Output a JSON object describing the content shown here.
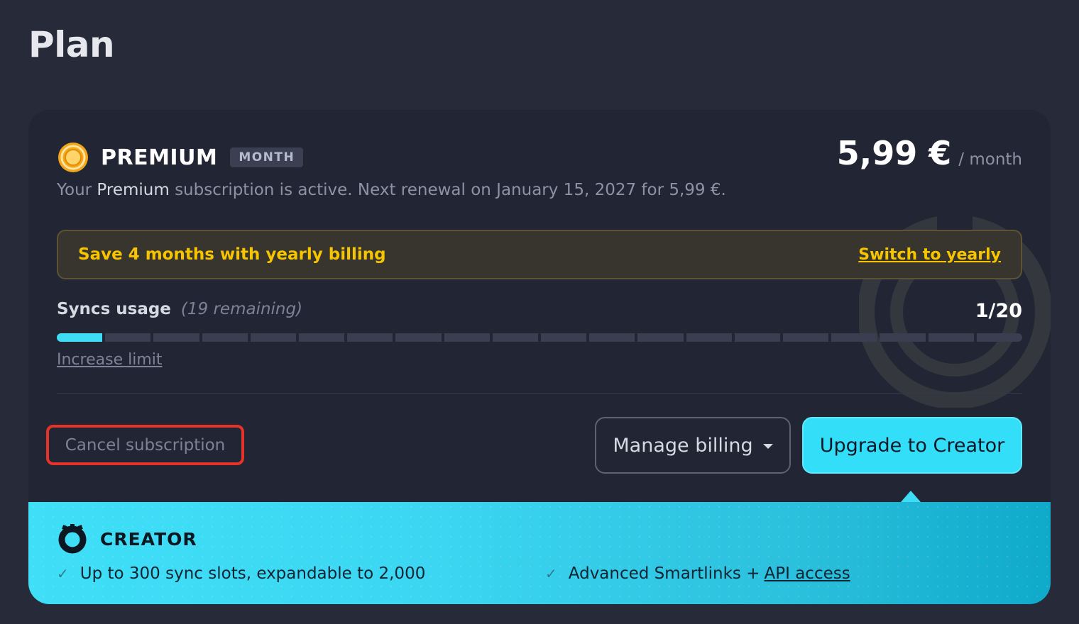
{
  "page": {
    "title": "Plan"
  },
  "plan": {
    "name": "PREMIUM",
    "period_badge": "MONTH",
    "price": "5,99 €",
    "price_period": "/ month",
    "status_prefix": "Your",
    "status_plan": "Premium",
    "status_suffix": "subscription is active. Next renewal on January 15, 2027 for 5,99 €."
  },
  "promo": {
    "text": "Save 4 months with yearly billing",
    "link_label": "Switch to yearly"
  },
  "usage": {
    "title": "Syncs usage",
    "remaining": "(19 remaining)",
    "count": "1/20",
    "used": 1,
    "limit": 20,
    "increase_label": "Increase limit"
  },
  "actions": {
    "cancel_label": "Cancel subscription",
    "manage_label": "Manage billing",
    "upgrade_label": "Upgrade to Creator"
  },
  "creator": {
    "name": "CREATOR",
    "feature_1": "Up to 300 sync slots, expandable to 2,000",
    "feature_2_text": "Advanced Smartlinks +",
    "feature_2_link": "API access"
  },
  "colors": {
    "accent": "#33def8",
    "promo_text": "#f6c500",
    "danger_outline": "#e5332a"
  },
  "icons": {
    "premium": "coin-icon",
    "creator": "creator-logo-icon",
    "check": "check-icon",
    "caret": "chevron-down-icon"
  }
}
